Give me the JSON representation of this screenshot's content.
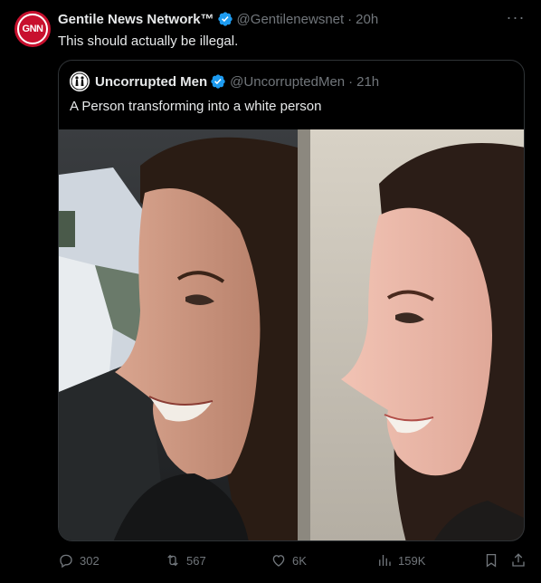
{
  "tweet": {
    "author_name": "Gentile News Network™",
    "handle": "@Gentilenewsnet",
    "separator": "·",
    "time": "20h",
    "avatar_text": "GNN",
    "text": "This should actually be illegal."
  },
  "quoted": {
    "author_name": "Uncorrupted Men",
    "handle": "@UncorruptedMen",
    "separator": "·",
    "time": "21h",
    "text": "A Person transforming into a white person"
  },
  "actions": {
    "replies": "302",
    "reposts": "567",
    "likes": "6K",
    "views": "159K"
  },
  "icons": {
    "verified": "verified-badge-icon",
    "more": "more-icon",
    "reply": "reply-icon",
    "repost": "repost-icon",
    "like": "like-icon",
    "views": "views-icon",
    "bookmark": "bookmark-icon",
    "share": "share-icon"
  },
  "colors": {
    "background": "#000000",
    "accent_verified": "#1d9bf0",
    "muted": "#71767b",
    "border": "#2f3336",
    "brand_red": "#c8102e"
  }
}
